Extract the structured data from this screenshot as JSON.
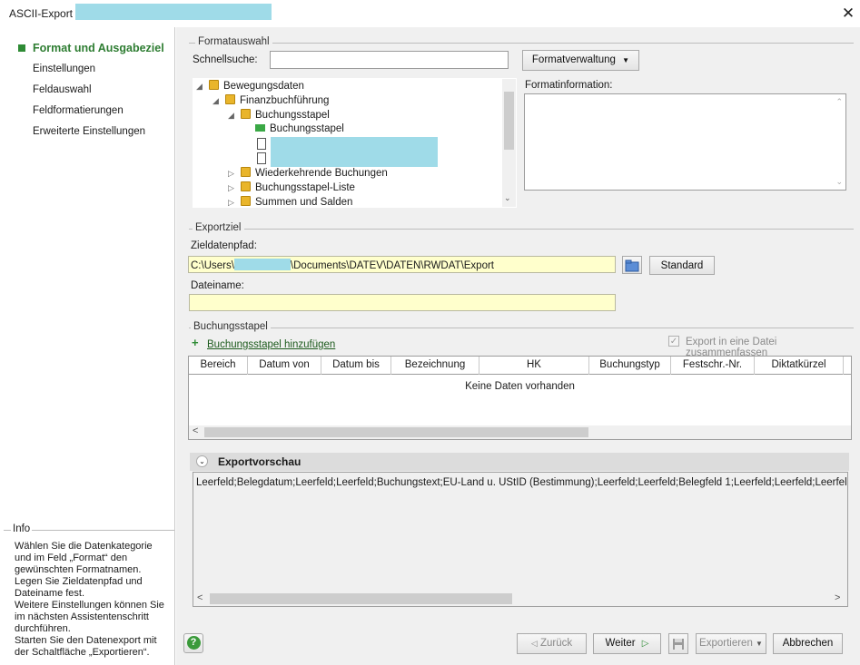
{
  "window": {
    "title": "ASCII-Export -",
    "close_glyph": "✕"
  },
  "sidebar": {
    "items": [
      {
        "label": "Format und Ausgabeziel"
      },
      {
        "label": "Einstellungen"
      },
      {
        "label": "Feldauswahl"
      },
      {
        "label": "Feldformatierungen"
      },
      {
        "label": "Erweiterte Einstellungen"
      }
    ],
    "info": {
      "title": "Info",
      "lines": [
        "Wählen Sie die Datenkategorie",
        "und im Feld „Format“ den",
        "gewünschten Formatnamen.",
        "Legen Sie Zieldatenpfad und",
        "Dateiname fest.",
        "Weitere Einstellungen können Sie",
        "im nächsten Assistentenschritt",
        "durchführen.",
        "Starten Sie den Datenexport mit",
        "der Schaltfläche „Exportieren“."
      ]
    }
  },
  "formatauswahl": {
    "title": "Formatauswahl",
    "schnellsuche_label": "Schnellsuche:",
    "schnellsuche_value": "",
    "formatverwaltung_label": "Formatverwaltung",
    "formatinformation_label": "Formatinformation:",
    "tree": [
      {
        "label": "Bewegungsdaten"
      },
      {
        "label": "Finanzbuchführung"
      },
      {
        "label": "Buchungsstapel"
      },
      {
        "label": "Buchungsstapel"
      },
      {
        "label": "Wiederkehrende Buchungen"
      },
      {
        "label": "Buchungsstapel-Liste"
      },
      {
        "label": "Summen und Salden"
      }
    ]
  },
  "exportziel": {
    "title": "Exportziel",
    "zieldatenpfad_label": "Zieldatenpfad:",
    "path_prefix": "C:\\Users\\",
    "path_suffix": "\\Documents\\DATEV\\DATEN\\RWDAT\\Export",
    "standard_label": "Standard",
    "dateiname_label": "Dateiname:",
    "dateiname_value": ""
  },
  "buchungsstapel": {
    "title": "Buchungsstapel",
    "add_label": "Buchungsstapel hinzufügen",
    "add_glyph": "+",
    "merge_label": "Export in eine Datei zusammenfassen",
    "columns": [
      "Bereich",
      "Datum von",
      "Datum bis",
      "Bezeichnung",
      "HK",
      "Buchungstyp",
      "Festschr.-Nr.",
      "Diktatkürzel"
    ],
    "empty_text": "Keine Daten vorhanden"
  },
  "preview": {
    "title": "Exportvorschau",
    "text": "Leerfeld;Belegdatum;Leerfeld;Leerfeld;Buchungstext;EU-Land u. UStID (Bestimmung);Leerfeld;Leerfeld;Belegfeld 1;Leerfeld;Leerfeld;Leerfeld;Le"
  },
  "footer": {
    "help_glyph": "?",
    "back_label": "Zurück",
    "next_label": "Weiter",
    "export_label": "Exportieren",
    "cancel_label": "Abbrechen"
  },
  "icons": {
    "help": "help-icon",
    "folder": "folder-icon",
    "save": "save-icon"
  },
  "colors": {
    "accent_green": "#2e7d32",
    "redaction": "#9fdbe8",
    "input_yellow": "#ffffcc"
  }
}
